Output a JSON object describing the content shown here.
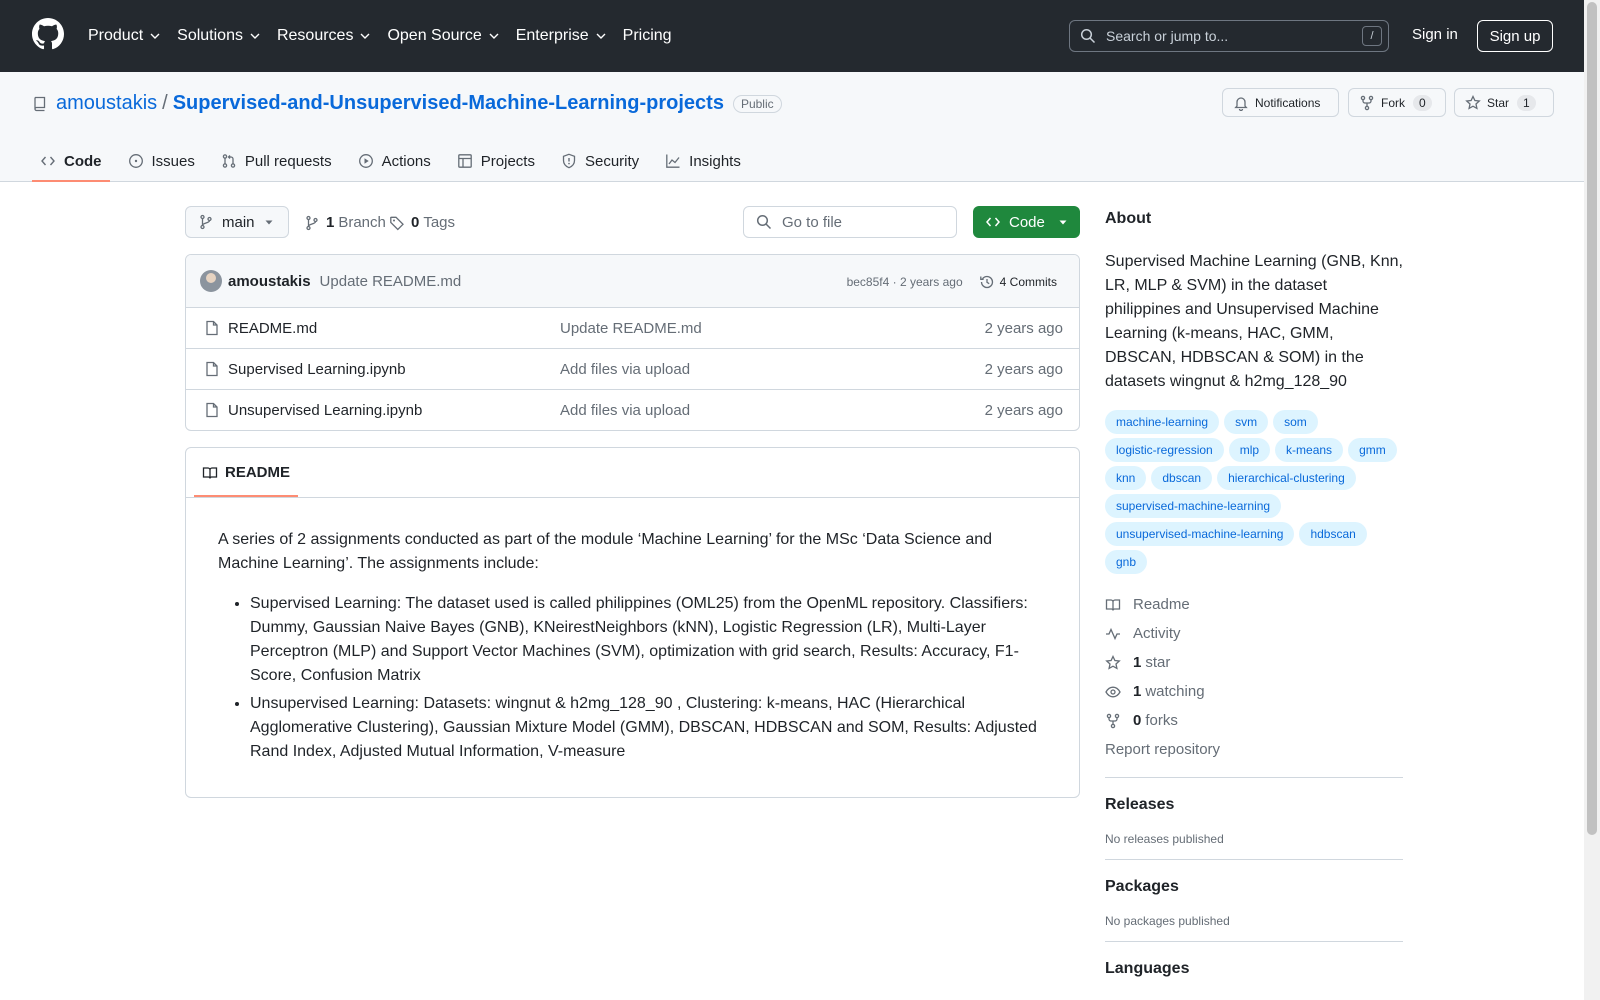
{
  "header": {
    "nav": [
      {
        "label": "Product"
      },
      {
        "label": "Solutions"
      },
      {
        "label": "Resources"
      },
      {
        "label": "Open Source"
      },
      {
        "label": "Enterprise"
      },
      {
        "label": "Pricing"
      }
    ],
    "search_placeholder": "Search or jump to...",
    "search_shortcut": "/",
    "sign_in": "Sign in",
    "sign_up": "Sign up"
  },
  "repo": {
    "owner": "amoustakis",
    "separator": "/",
    "name": "Supervised-and-Unsupervised-Machine-Learning-projects",
    "visibility": "Public",
    "notifications_label": "Notifications",
    "fork_label": "Fork",
    "fork_count": "0",
    "star_label": "Star",
    "star_count": "1"
  },
  "tabs": [
    {
      "label": "Code"
    },
    {
      "label": "Issues"
    },
    {
      "label": "Pull requests"
    },
    {
      "label": "Actions"
    },
    {
      "label": "Projects"
    },
    {
      "label": "Security"
    },
    {
      "label": "Insights"
    }
  ],
  "filenav": {
    "branch": "main",
    "branch_count": "1",
    "branch_label": "Branch",
    "tag_count": "0",
    "tag_label": "Tags",
    "goto_placeholder": "Go to file",
    "code_button": "Code"
  },
  "latest_commit": {
    "author": "amoustakis",
    "message": "Update README.md",
    "hash": "bec85f4",
    "time": "2 years ago",
    "commits_label": "4 Commits"
  },
  "files": [
    {
      "name": "README.md",
      "message": "Update README.md",
      "date": "2 years ago"
    },
    {
      "name": "Supervised Learning.ipynb",
      "message": "Add files via upload",
      "date": "2 years ago"
    },
    {
      "name": "Unsupervised Learning.ipynb",
      "message": "Add files via upload",
      "date": "2 years ago"
    }
  ],
  "readme": {
    "tab_label": "README",
    "intro": "A series of 2 assignments conducted as part of the module ‘Machine Learning’ for the MSc ‘Data Science and Machine Learning’. The assignments include:",
    "items": [
      "Supervised Learning: The dataset used is called philippines (OML25) from the OpenML repository. Classifiers: Dummy, Gaussian Naive Bayes (GNB), KNeirestNeighbors (kNN), Logistic Regression (LR), Multi-Layer Perceptron (MLP) and Support Vector Machines (SVM), optimization with grid search, Results: Accuracy, F1-Score, Confusion Matrix",
      "Unsupervised Learning: Datasets: wingnut & h2mg_128_90 , Clustering: k-means, HAC (Hierarchical Agglomerative Clustering), Gaussian Mixture Model (GMM), DBSCAN, HDBSCAN and SOM, Results: Adjusted Rand Index, Adjusted Mutual Information, V-measure"
    ]
  },
  "about": {
    "title": "About",
    "description": "Supervised Machine Learning (GNB, Knn, LR, MLP & SVM) in the dataset philippines and Unsupervised Machine Learning (k-means, HAC, GMM, DBSCAN, HDBSCAN & SOM) in the datasets wingnut & h2mg_128_90",
    "topics": [
      "machine-learning",
      "svm",
      "som",
      "logistic-regression",
      "mlp",
      "k-means",
      "gmm",
      "knn",
      "dbscan",
      "hierarchical-clustering",
      "supervised-machine-learning",
      "unsupervised-machine-learning",
      "hdbscan",
      "gnb"
    ],
    "readme_label": "Readme",
    "activity_label": "Activity",
    "stars_count": "1",
    "stars_label": "star",
    "watching_count": "1",
    "watching_label": "watching",
    "forks_count": "0",
    "forks_label": "forks",
    "report_label": "Report repository"
  },
  "releases": {
    "title": "Releases",
    "note": "No releases published"
  },
  "packages": {
    "title": "Packages",
    "note": "No packages published"
  },
  "languages": {
    "title": "Languages"
  },
  "colors": {
    "accent": "#0969da",
    "header_bg": "#24292f",
    "code_button": "#1f883d",
    "tab_underline": "#fd8c73",
    "topic_bg": "#ddf4ff"
  }
}
